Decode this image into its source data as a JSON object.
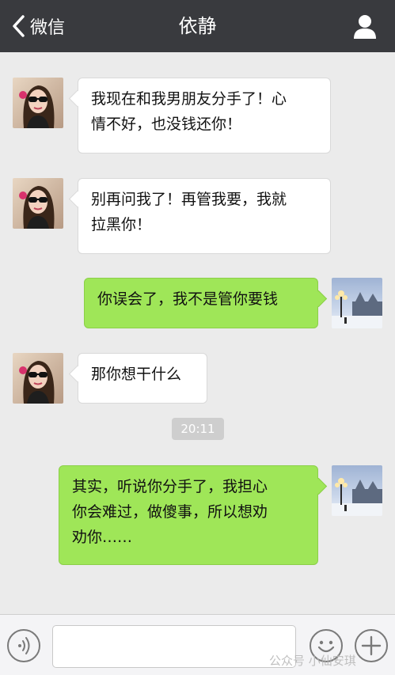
{
  "header": {
    "back_label": "微信",
    "title": "依静"
  },
  "messages": [
    {
      "side": "in",
      "text_line1": "我现在和我男朋友分手了！心",
      "text_line2": "情不好，也没钱还你！"
    },
    {
      "side": "in",
      "text_line1": "别再问我了！再管我要，我就",
      "text_line2": "拉黑你！"
    },
    {
      "side": "out",
      "text_line1": "你误会了，我不是管你要钱"
    },
    {
      "side": "in",
      "text_line1": "那你想干什么"
    },
    {
      "side": "out",
      "text_line1": "其实，听说你分手了，我担心",
      "text_line2": "你会难过，做傻事，所以想劝",
      "text_line3": "劝你……"
    }
  ],
  "timestamp": "20:11",
  "input": {
    "value": "",
    "placeholder": ""
  },
  "watermark": "公众号 小仙安琪",
  "colors": {
    "header_bg": "#393a3e",
    "chat_bg": "#ebebeb",
    "incoming_bubble": "#ffffff",
    "outgoing_bubble": "#9fe658",
    "timestamp_bg": "#cecece"
  },
  "icons": {
    "back": "chevron-left-icon",
    "profile": "person-icon",
    "voice": "voice-icon",
    "emoji": "smiley-icon",
    "more": "plus-icon"
  }
}
